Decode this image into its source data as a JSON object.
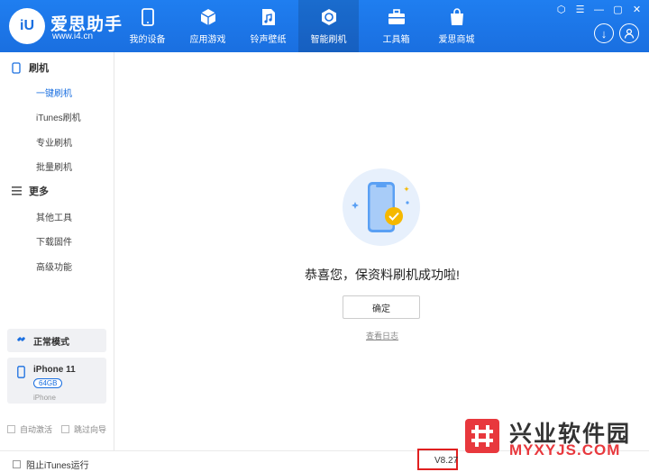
{
  "app": {
    "brand_name": "爱思助手",
    "brand_url": "www.i4.cn",
    "accent": "#1a6fe0"
  },
  "nav": [
    {
      "label": "我的设备",
      "icon": "phone-icon"
    },
    {
      "label": "应用游戏",
      "icon": "cube-icon"
    },
    {
      "label": "铃声壁纸",
      "icon": "music-file-icon"
    },
    {
      "label": "智能刷机",
      "icon": "refresh-icon",
      "active": true
    },
    {
      "label": "工具箱",
      "icon": "toolbox-icon"
    },
    {
      "label": "爱思商城",
      "icon": "shopping-bag-icon"
    }
  ],
  "sidebar": {
    "flash_section": "刷机",
    "flash_items": [
      "一键刷机",
      "iTunes刷机",
      "专业刷机",
      "批量刷机"
    ],
    "more_section": "更多",
    "more_items": [
      "其他工具",
      "下载固件",
      "高级功能"
    ],
    "mode": "正常模式",
    "device": {
      "name": "iPhone 11",
      "storage": "64GB",
      "type": "iPhone"
    },
    "auto_activate": "自动激活",
    "skip_guide": "跳过向导"
  },
  "main": {
    "success_message": "恭喜您，保资料刷机成功啦!",
    "ok_button": "确定",
    "view_log": "查看日志"
  },
  "bottom": {
    "block_itunes": "阻止iTunes运行",
    "version": "V8.27"
  },
  "watermark": {
    "title": "兴业软件园",
    "subtitle": "MYXYJS.COM"
  }
}
